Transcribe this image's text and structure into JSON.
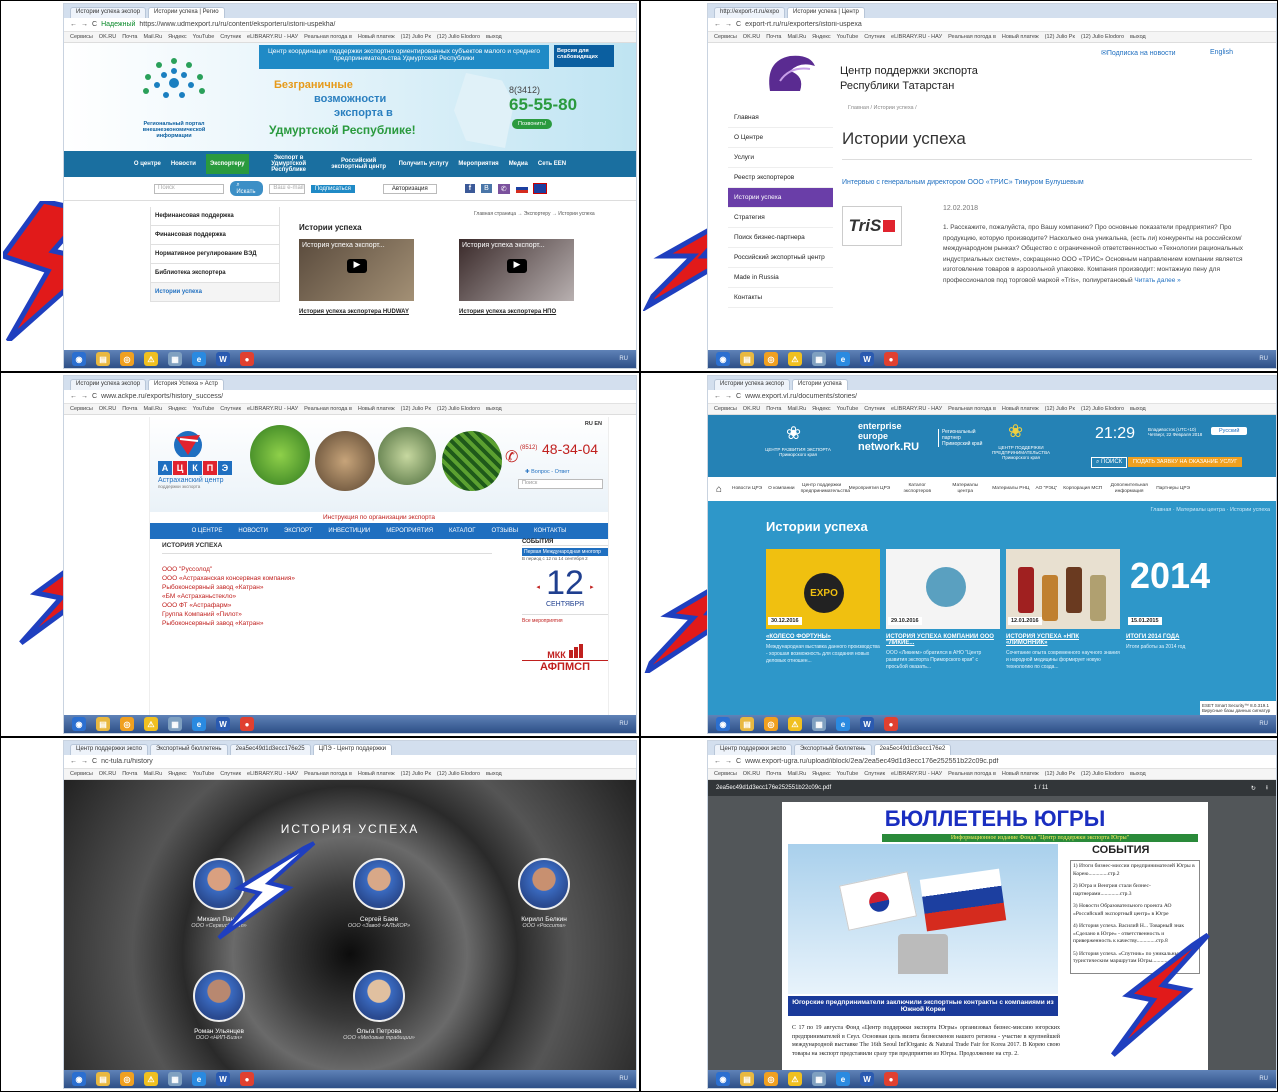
{
  "p1": {
    "tabs": [
      "Истории успеха экспор",
      "Истории успеха | Регио"
    ],
    "url": "https://www.udmexport.ru/ru/content/eksporteru/istorii-uspekha/",
    "secure": "Надежный",
    "bookmarks": [
      "Сервисы",
      "OK.RU",
      "Почта",
      "Mail.Ru",
      "Яндекс",
      "YouTube",
      "Спутник",
      "eLIBRARY.RU - НАУ",
      "Реальная погода в",
      "Новый платеж",
      "(12) Julio Рк",
      "(12) Julio Elodoro",
      "выход"
    ],
    "header_tagline": "Центр координации поддержки экспортно ориентированных субъектов малого и среднего предпринимательства Удмуртской Республики",
    "version_btn": "Версия для слабовидящих",
    "logo_text": "Региональный портал внешнеэкономической информации",
    "slogan1": "Безграничные",
    "slogan2": "возможности",
    "slogan3": "экспорта в",
    "slogan4": "Удмуртской Республике!",
    "phone_code": "8(3412)",
    "phone": "65-55-80",
    "call_btn": "Позвонить!",
    "nav": [
      "О центре",
      "Новости",
      "Экспортеру",
      "Экспорт в Удмуртской Республике",
      "Российский экспортный центр",
      "Получить услугу",
      "Мероприятия",
      "Медиа",
      "Сеть EEN"
    ],
    "search_ph": "Поиск",
    "search_btn": "Искать",
    "email_ph": "Ваш e-mail",
    "subscribe_btn": "Подписаться",
    "auth": "Авторизация",
    "sidebar": [
      "Нефинансовая поддержка",
      "Финансовая поддержка",
      "Нормативное регулирование ВЭД",
      "Библиотека экспортера",
      "Истории успеха"
    ],
    "breadcrumb": "Главная страница → Экспортеру → Истории успеха",
    "section_title": "Истории успеха",
    "video1": "История успеха экспорт...",
    "video2": "История успеха экспорт...",
    "cap1": "История успеха экспортера HUDWAY",
    "cap2": "История успеха экспортера НПО"
  },
  "p2": {
    "tabs": [
      "http://export-rt.ru/expo",
      "Истории успеха | Центр"
    ],
    "url": "export-rt.ru/ru/exporters/istorii-uspexa",
    "bookmarks": [
      "Сервисы",
      "OK.RU",
      "Почта",
      "Mail.Ru",
      "Яндекс",
      "YouTube",
      "Спутник",
      "eLIBRARY.RU - НАУ",
      "Реальная погода в",
      "Новый платеж",
      "(12) Julio Рк",
      "(12) Julio Elodoro",
      "выход"
    ],
    "title1": "Центр поддержки экспорта",
    "title2": "Республики Татарстан",
    "subscribe": "Подписка на новости",
    "english": "English",
    "menu": [
      "Главная",
      "О Центре",
      "Услуги",
      "Реестр экспортеров",
      "Истории успеха",
      "Стратегия",
      "Поиск бизнес-партнера",
      "Российский экспортный центр",
      "Made in Russia",
      "Контакты"
    ],
    "breadcrumb": "Главная / Истории успеха /",
    "heading": "Истории успеха",
    "article_title": "Интервью с генеральным директором ООО «ТРИС» Тимуром Булушевым",
    "date": "12.02.2018",
    "logo": "TriS",
    "article_text": "1. Расскажите, пожалуйста, про Вашу компанию? Про основные показатели предприятия? Про продукцию, которую производите? Насколько она уникальна, (есть ли) конкуренты на российском/ международном рынках? Общество с ограниченной ответственностью «Технологии рациональных индустриальных систем», сокращенно ООО «ТРИС» Основным направлением компании является изготовление товаров в аэрозольной упаковке. Компания производит: монтажную пену для профессионалов под торговой маркой «Tris», полиуретановый",
    "read_more": "Читать далее »"
  },
  "p3": {
    "tabs": [
      "Истории успеха экспор",
      "История Успеха » Астр"
    ],
    "url": "www.ackpe.ru/exports/history_success/",
    "bookmarks": [
      "Сервисы",
      "OK.RU",
      "Почта",
      "Mail.Ru",
      "Яндекс",
      "YouTube",
      "Спутник",
      "eLIBRARY.RU - НАУ",
      "Реальная погода в",
      "Новый платеж",
      "(12) Julio Рк",
      "(12) Julio Elodoro",
      "выход"
    ],
    "logo_letters": [
      "А",
      "Ц",
      "К",
      "П",
      "Э"
    ],
    "logo_sub": "Астраханский центр",
    "logo_sub2": "поддержки экспорта",
    "phone_code": "(8512)",
    "phone": "48-34-04",
    "qa": "Вопрос - Ответ",
    "search_ph": "Поиск",
    "lang": "RU EN",
    "instruction": "Инструкция по организации экспорта",
    "nav": [
      "О ЦЕНТРЕ",
      "НОВОСТИ",
      "ЭКСПОРТ",
      "ИНВЕСТИЦИИ",
      "МЕРОПРИЯТИЯ",
      "КАТАЛОГ",
      "ОТЗЫВЫ",
      "КОНТАКТЫ"
    ],
    "section": "ИСТОРИЯ УСПЕХА",
    "links": [
      "ООО \"Руссолод\"",
      "ООО «Астраханская консервная компания»",
      "Рыбоконсервный завод «Катран»",
      "«БМ «Астраханьстекло»",
      "ООО ФТ «Астрафарм»",
      "Группа Компаний «Пилот»",
      "Рыбоконсервный завод «Катран»"
    ],
    "events_title": "СОБЫТИЯ",
    "event_text": "Первая Международная многопр",
    "event_period": "В период с 12 по 14 сентября 2",
    "day": "12",
    "month": "СЕНТЯБРЯ",
    "all_events": "Все мероприятия",
    "mkk": "МКК",
    "afp": "АФПМСП"
  },
  "p4": {
    "tabs": [
      "Истории успеха экспор",
      "Истории успеха"
    ],
    "url": "www.export.vl.ru/documents/stories/",
    "bookmarks": [
      "Сервисы",
      "OK.RU",
      "Почта",
      "Mail.Ru",
      "Яндекс",
      "YouTube",
      "Спутник",
      "eLIBRARY.RU - НАУ",
      "Реальная погода в",
      "Новый платеж",
      "(12) Julio Рк",
      "(12) Julio Elodoro",
      "выход"
    ],
    "org1": "ЦЕНТР РАЗВИТИЯ ЭКСПОРТА Приморского края",
    "een1": "enterprise",
    "een2": "europe",
    "een3": "network.RU",
    "een_side": "Региональный партнер Приморский край",
    "org2": "ЦЕНТР ПОДДЕРЖКИ ПРЕДПРИНИМАТЕЛЬСТВА Приморского края",
    "time": "21:29",
    "date_info": "Владивосток (UTC+10) Четверг, 22 Февраля 2018",
    "lang": "Русский",
    "search": "ПОИСК",
    "apply_btn": "ПОДАТЬ ЗАЯВКУ НА ОКАЗАНИЕ УСЛУГ",
    "nav": [
      "Новости ЦРЭ",
      "О компании",
      "Центр поддержки предпринимательства",
      "Мероприятия ЦРЭ",
      "Каталог экспортеров",
      "Материалы центра",
      "Материалы РНЦ",
      "АО \"РЭЦ\"",
      "Корпорация МСП",
      "Дополнительная информация",
      "Партнеры ЦРЭ"
    ],
    "breadcrumb": "Главная · Материалы центра · Истории успеха",
    "heading": "Истории успеха",
    "cards": [
      {
        "date": "30.12.2016",
        "title": "«КОЛЕСО ФОРТУНЫ»",
        "text": "Международная выставка данного производства - хорошая возможность для создания новых деловых отношен..."
      },
      {
        "date": "29.10.2016",
        "title": "ИСТОРИЯ УСПЕХА КОМПАНИИ ООО \"ЛИКИЕ...",
        "text": "ООО «Ликием» обратился в АНО \"Центр развития экспорта Приморского края\" с просьбой оказать..."
      },
      {
        "date": "12.01.2016",
        "title": "ИСТОРИЯ УСПЕХА «НПК «ЛИМОННИК»",
        "text": "Сочетание опыта современного научного знания и народной медицины формирует новую технологию по созда..."
      },
      {
        "date": "15.01.2015",
        "title": "ИТОГИ 2014 ГОДА",
        "text": "Итоги работы за 2014 год"
      }
    ],
    "year_badge": "2014",
    "expo_badge": "EXPO",
    "eset": "ESET Smart Security™ 8.0.319.1 Вирусные базы данных сигнатур"
  },
  "p5": {
    "tabs": [
      "Центр поддержки экспо",
      "Экспортный бюллетень",
      "2ea5ec49d1d3ecc176e25",
      "ЦПЭ - Центр поддержки"
    ],
    "url": "nc-tula.ru/history",
    "bookmarks": [
      "Сервисы",
      "OK.RU",
      "Почта",
      "Mail.Ru",
      "Яндекс",
      "YouTube",
      "Спутник",
      "eLIBRARY.RU - НАУ",
      "Реальная погода в",
      "Новый платеж",
      "(12) Julio Рк",
      "(12) Julio Elodoro",
      "выход"
    ],
    "heading": "ИСТОРИЯ УСПЕХА",
    "people": [
      {
        "name": "Михаил Панкр",
        "company": "ООО «СервисСофт»"
      },
      {
        "name": "Сергей Баев",
        "company": "ООО «Завод «АЛЬКОР»"
      },
      {
        "name": "Кирилл Белкин",
        "company": "ООО «Россита»"
      },
      {
        "name": "Роман Ульянцев",
        "company": "ООО «НИП-Бизн»"
      },
      {
        "name": "Ольга Петрова",
        "company": "ООО «Медовые традиции»"
      }
    ]
  },
  "p6": {
    "tabs": [
      "Центр поддержки экспо",
      "Экспортный бюллетень",
      "2ea5ec49d1d3ecc176e2"
    ],
    "url": "www.export-ugra.ru/upload/iblock/2ea/2ea5ec49d1d3ecc176e252551b22c09c.pdf",
    "bookmarks": [
      "Сервисы",
      "OK.RU",
      "Почта",
      "Mail.Ru",
      "Яндекс",
      "YouTube",
      "Спутник",
      "eLIBRARY.RU - НАУ",
      "Реальная погода в",
      "Новый платеж",
      "(12) Julio Рк",
      "(12) Julio Elodoro",
      "выход"
    ],
    "pdf_name": "2ea5ec49d1d3ecc176e252551b22c09c.pdf",
    "page": "1 / 11",
    "doc_title": "БЮЛЛЕТЕНЬ ЮГРЫ",
    "doc_sub": "Информационное издание Фонда \"Центр поддержки экспорта Югры\"",
    "events": "СОБЫТИЯ",
    "toc": [
      "1) Итоги бизнес-миссии предпринимателей Югры в Корею..............стр.2",
      "2) Югра и Венгрия стали бизнес-партнерами..............стр.3",
      "3) Новости Образовательного проекта АО «Российский экспортный центр» в Югре",
      "4) История успеха. Василий Н... Товарный знак «Сделано в Югре» - ответственность и приверженность к качеству..............стр.8",
      "5) История успеха. «Спутник» по уникальным туристическим маршрутам Югры..............стр.10"
    ],
    "photo_caption": "Югорские предприниматели заключили экспортные контракты с компаниями из Южной Кореи",
    "body": "С 17 по 19 августа Фонд «Центр поддержки экспорта Югры» организовал бизнес-миссию югорских предпринимателей в Сеул. Основная цель визита бизнесменов нашего региона - участие в крупнейшей международной выставке The 16th Seoul Int'lOrganic & Natural Trade Fair for Korea 2017. В Корею свою товары на экспорт представили сразу три предприятия из Югры. Продолжение на стр. 2."
  },
  "taskbar": {
    "lang": "RU"
  },
  "colors": {
    "bolt_red": "#e11a1a",
    "bolt_blue": "#1f3fbf",
    "bolt_white": "#ffffff"
  }
}
